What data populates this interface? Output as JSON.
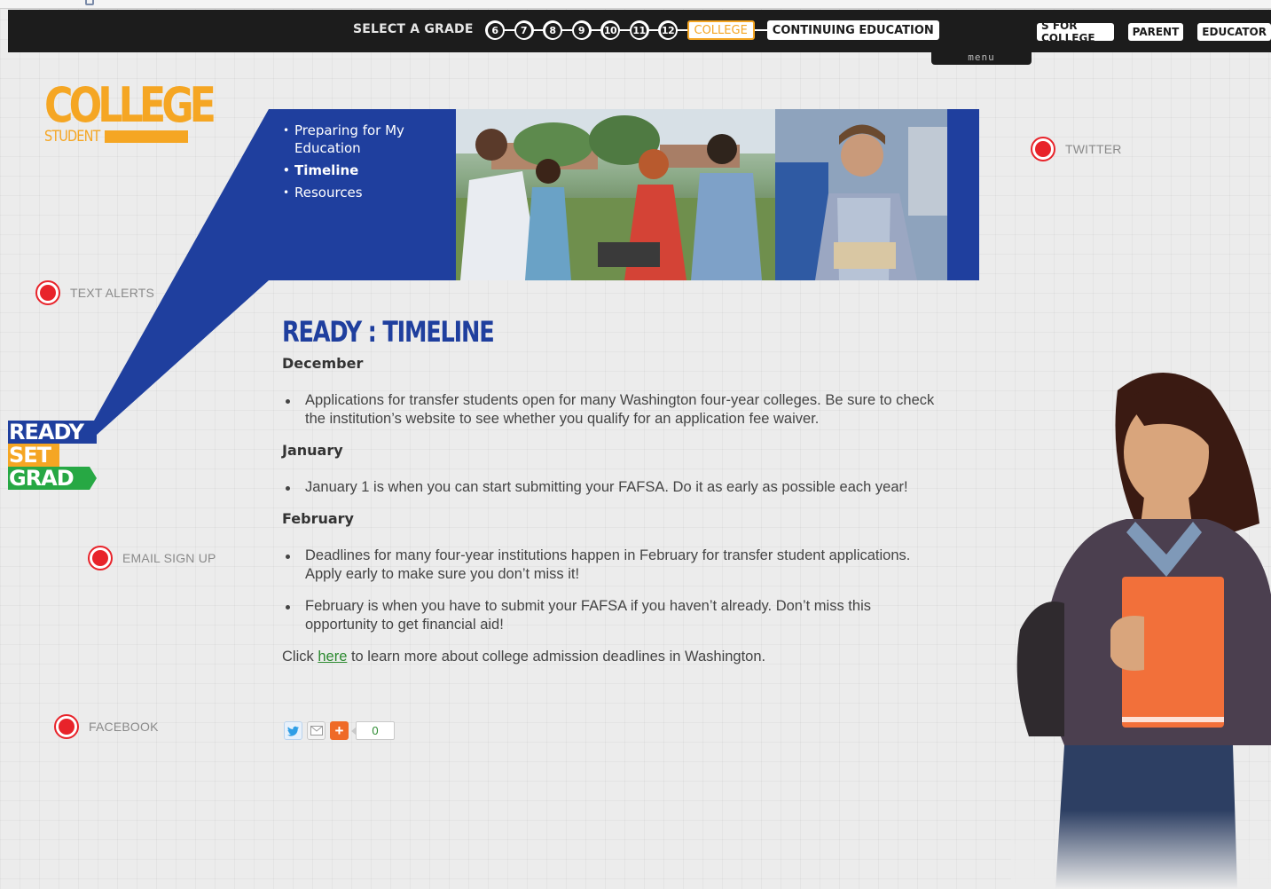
{
  "topbar": {
    "select_grade_label": "SELECT A GRADE",
    "grades": [
      "6",
      "7",
      "8",
      "9",
      "10",
      "11",
      "12"
    ],
    "college_label": "COLLEGE",
    "continuing_label": "CONTINUING EDUCATION",
    "audience": [
      "S FOR COLLEGE",
      "PARENT",
      "EDUCATOR"
    ],
    "menu_label": "menu"
  },
  "logo": {
    "title": "COLLEGE",
    "subtitle": "STUDENT"
  },
  "hero_nav": {
    "items": [
      {
        "label": "Preparing for My Education",
        "active": false
      },
      {
        "label": "Timeline",
        "active": true
      },
      {
        "label": "Resources",
        "active": false
      }
    ]
  },
  "social": {
    "twitter": "TWITTER",
    "text_alerts": "TEXT ALERTS",
    "email_sign_up": "EMAIL SIGN UP",
    "facebook": "FACEBOOK"
  },
  "ready_set_grad": {
    "ready": "READY",
    "set": "SET",
    "grad": "GRAD"
  },
  "content": {
    "page_title": "READY : TIMELINE",
    "months": [
      {
        "name": "December",
        "items": [
          "Applications for transfer students open for many Washington four-year colleges. Be sure to check the institution’s website to see whether you qualify for an application fee waiver."
        ]
      },
      {
        "name": "January",
        "items": [
          "January 1 is when you can start submitting your FAFSA. Do it as early as possible each year!"
        ]
      },
      {
        "name": "February",
        "items": [
          "Deadlines for many four-year institutions happen in February for transfer student applications. Apply early to make sure you don’t miss it!",
          "February is when you have to submit your FAFSA if you haven’t already. Don’t miss this opportunity to get financial aid!"
        ]
      }
    ],
    "click_prefix": "Click ",
    "click_link": "here",
    "click_suffix": " to learn more about college admission deadlines in Washington."
  },
  "share": {
    "plus": "+",
    "count": "0"
  },
  "colors": {
    "brand_blue": "#1f3f9e",
    "brand_orange": "#f5a623",
    "brand_green": "#27a844",
    "social_red": "#e8232a",
    "topbar_black": "#1c1c1c"
  }
}
